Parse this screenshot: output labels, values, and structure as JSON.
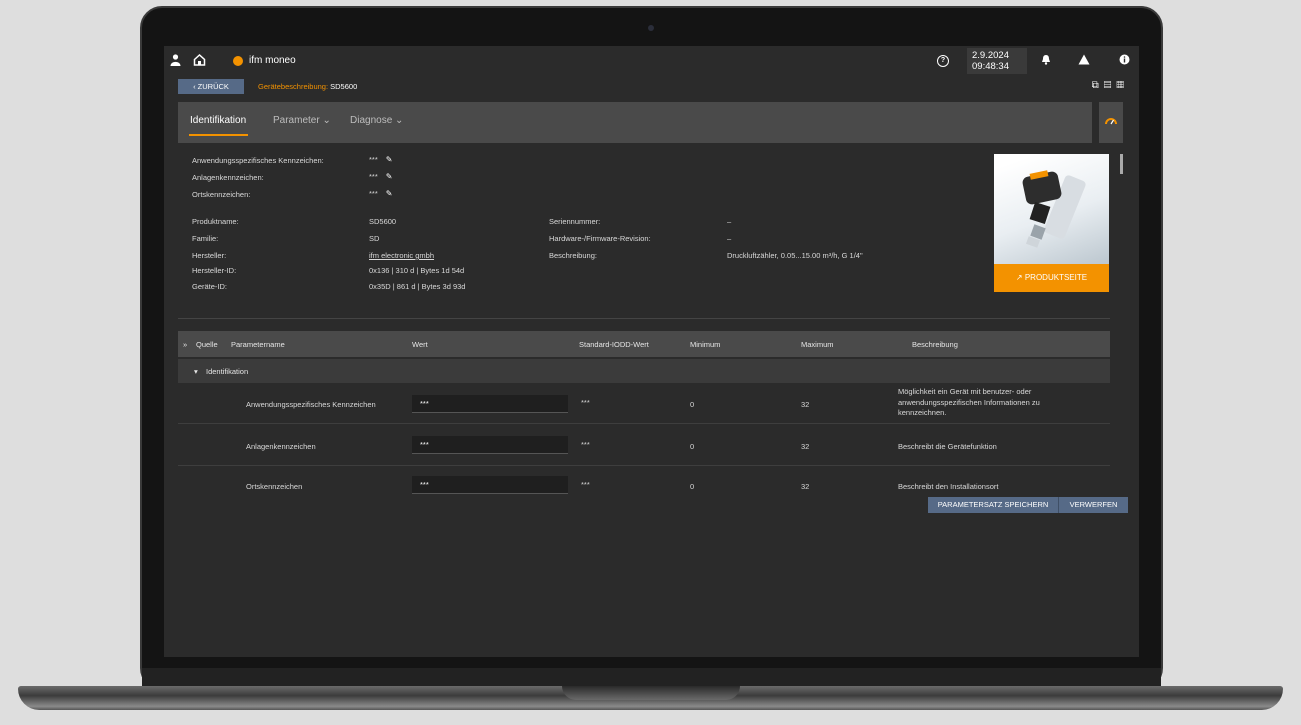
{
  "app": {
    "name": "ifm moneo"
  },
  "header": {
    "date": "2.9.2024",
    "time": "09:48:34"
  },
  "subheader": {
    "back_label": "ZURÜCK",
    "crumb_label": "Gerätebeschreibung:",
    "crumb_value": "SD5600"
  },
  "tabs": [
    {
      "label": "Identifikation"
    },
    {
      "label": "Parameter"
    },
    {
      "label": "Diagnose"
    }
  ],
  "identification": {
    "editable": [
      {
        "label": "Anwendungsspezifisches Kennzeichen:",
        "value": "***"
      },
      {
        "label": "Anlagenkennzeichen:",
        "value": "***"
      },
      {
        "label": "Ortskennzeichen:",
        "value": "***"
      }
    ],
    "left": [
      {
        "label": "Produktname:",
        "value": "SD5600"
      },
      {
        "label": "Familie:",
        "value": "SD"
      },
      {
        "label": "Hersteller:",
        "value": "ifm electronic gmbh"
      },
      {
        "label": "Hersteller-ID:",
        "value": "0x136 | 310 d | Bytes 1d 54d"
      },
      {
        "label": "Geräte-ID:",
        "value": "0x35D | 861 d | Bytes 3d 93d"
      }
    ],
    "right": [
      {
        "label": "Seriennummer:",
        "value": "–"
      },
      {
        "label": "Hardware-/Firmware-Revision:",
        "value": "–"
      },
      {
        "label": "Beschreibung:",
        "value": "Druckluftzähler, 0.05...15.00 m³/h, G 1/4\""
      }
    ],
    "product_button": "PRODUKTSEITE"
  },
  "table": {
    "headers": [
      "Quelle",
      "Parametername",
      "Wert",
      "Standard-IODD-Wert",
      "Minimum",
      "Maximum",
      "Beschreibung"
    ],
    "group": "Identifikation",
    "rows": [
      {
        "name": "Anwendungsspezifisches Kennzeichen",
        "value": "***",
        "default": "***",
        "min": "0",
        "max": "32",
        "desc": [
          "Möglichkeit ein Gerät mit benutzer- oder",
          "anwendungsspezifischen Informationen zu",
          "kennzeichnen."
        ]
      },
      {
        "name": "Anlagenkennzeichen",
        "value": "***",
        "default": "***",
        "min": "0",
        "max": "32",
        "desc": [
          "Beschreibt die Gerätefunktion"
        ]
      },
      {
        "name": "Ortskennzeichen",
        "value": "***",
        "default": "***",
        "min": "0",
        "max": "32",
        "desc": [
          "Beschreibt den Installationsort"
        ]
      }
    ]
  },
  "actions": {
    "save": "PARAMETERSATZ SPEICHERN",
    "discard": "VERWERFEN"
  },
  "colors": {
    "accent": "#f39200",
    "button": "#566a87",
    "background": "#2b2b2b"
  }
}
